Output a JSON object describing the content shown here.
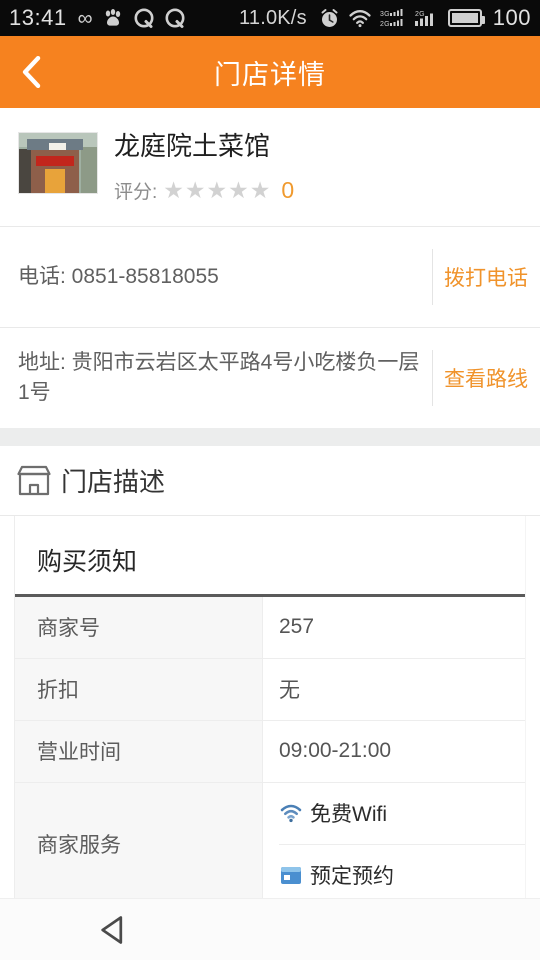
{
  "statusbar": {
    "time": "13:41",
    "network_speed": "11.0K/s",
    "battery_level": "100",
    "icons": [
      "infinity-icon",
      "baidu-paw-icon",
      "qq-icon",
      "qq-icon-2",
      "alarm-clock-icon",
      "wifi-icon",
      "signal-3g-2g-icon",
      "signal-2g-icon",
      "battery-icon"
    ]
  },
  "appbar": {
    "title": "门店详情",
    "back_icon": "chevron-left-icon",
    "background_color": "#f6821f"
  },
  "store": {
    "name": "龙庭院土菜馆",
    "thumbnail_alt": "storefront-photo",
    "rating_label": "评分:",
    "rating_value": "0",
    "star_glyph": "★",
    "star_count": 5,
    "star_color": "#d2d2d2",
    "rating_value_color": "#f09a2e"
  },
  "contact": {
    "phone": {
      "text": "电话: 0851-85818055",
      "action_label": "拨打电话",
      "action_color": "#f0932b"
    },
    "address": {
      "text": "地址: 贵阳市云岩区太平路4号小吃楼负一层1号",
      "action_label": "查看路线",
      "action_color": "#f0932b"
    }
  },
  "description": {
    "section_icon": "shop-icon",
    "section_title": "门店描述",
    "inner_title": "购买须知",
    "table": {
      "rows": [
        {
          "label": "商家号",
          "value": "257"
        },
        {
          "label": "折扣",
          "value": "无"
        },
        {
          "label": "营业时间",
          "value": "09:00-21:00"
        }
      ],
      "services_label": "商家服务",
      "services": [
        {
          "icon": "wifi-icon",
          "label": "免费Wifi"
        },
        {
          "icon": "reservation-icon",
          "label": "预定预约"
        }
      ]
    }
  },
  "navbar": {
    "back_icon": "triangle-back-icon"
  }
}
